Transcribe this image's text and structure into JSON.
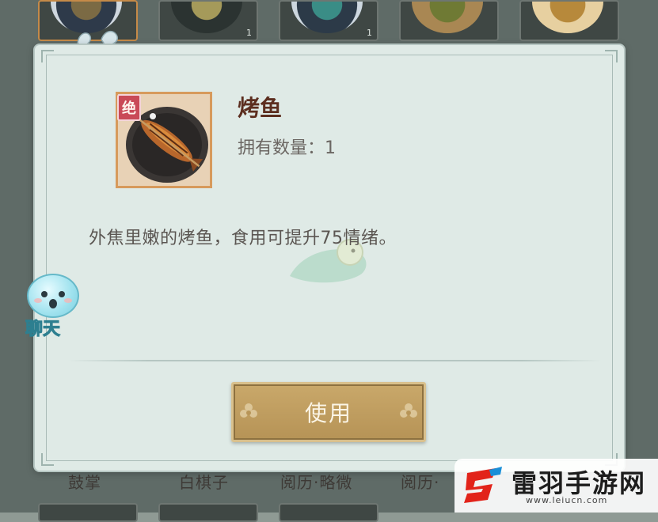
{
  "item": {
    "name": "烤鱼",
    "rarity_badge": "绝",
    "quantity_label": "拥有数量：1",
    "description": "外焦里嫩的烤鱼，食用可提升75情绪。",
    "icon": "grilled-fish-icon"
  },
  "actions": {
    "use_label": "使用"
  },
  "chat": {
    "label": "聊天",
    "icon": "chat-face-icon"
  },
  "background": {
    "slots": [
      {
        "qty": ""
      },
      {
        "qty": "1"
      },
      {
        "qty": "1"
      },
      {
        "qty": ""
      },
      {
        "qty": ""
      }
    ],
    "bottom_labels": [
      "鼓掌",
      "白棋子",
      "阅历·略微",
      "阅历·"
    ]
  },
  "watermark": {
    "text": "雷羽手游网",
    "url": "www.leiucn.com"
  },
  "colors": {
    "modal_bg": "#dfeae6",
    "button_gold": "#c9a86a",
    "title_brown": "#5c2e1f",
    "rarity_red": "#c94a58"
  }
}
